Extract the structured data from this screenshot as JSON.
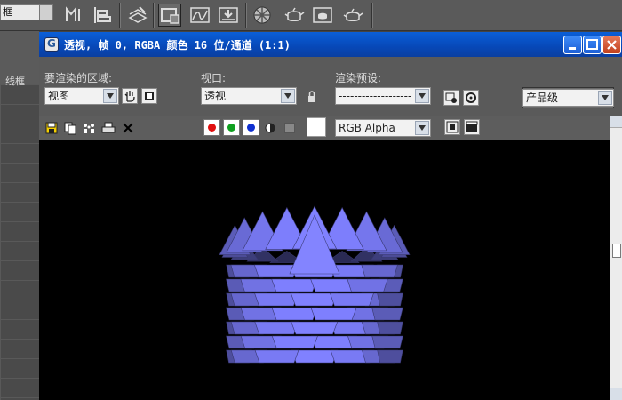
{
  "toolbar": {
    "dropdown_value": "框"
  },
  "background_viewport": {
    "label": "线框"
  },
  "render_window": {
    "title": "透视, 帧 0, RGBA 颜色 16 位/通道 (1:1)",
    "area_label": "要渲染的区域:",
    "area_value": "视图",
    "viewport_label": "视口:",
    "viewport_value": "透视",
    "preset_label": "渲染预设:",
    "preset_value": "-------------------",
    "render_button": "渲染",
    "level_value": "产品级",
    "channel_value": "RGB Alpha"
  },
  "colors": {
    "title_bar": "#0a5fd8",
    "object_fill": "#6f70e0",
    "red_channel": "#e01010",
    "green_channel": "#10a020",
    "blue_channel": "#1030d0"
  }
}
